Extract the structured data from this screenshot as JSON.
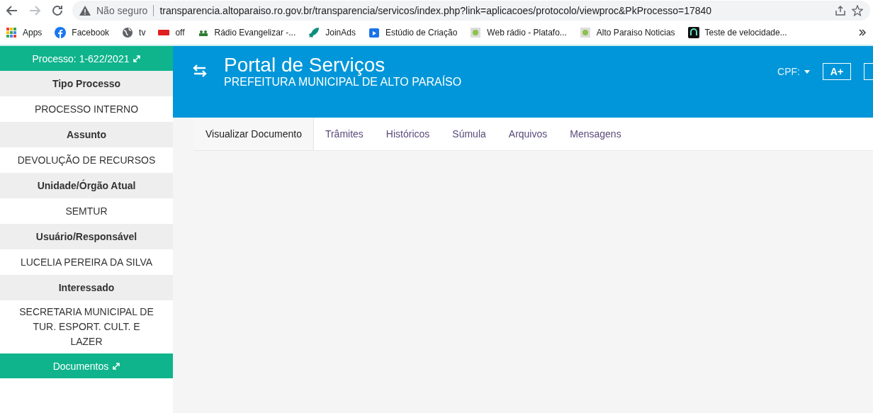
{
  "browser": {
    "security": "Não seguro",
    "url": "transparencia.altoparaiso.ro.gov.br/transparencia/servicos/index.php?link=aplicacoes/protocolo/viewproc&PkProcesso=17840",
    "bookmarks": [
      {
        "label": "Apps",
        "kind": "apps"
      },
      {
        "label": "Facebook",
        "kind": "facebook"
      },
      {
        "label": "tv",
        "kind": "globe"
      },
      {
        "label": "off",
        "kind": "badge"
      },
      {
        "label": "Rádio Evangelizar -...",
        "kind": "people"
      },
      {
        "label": "JoinAds",
        "kind": "rocket"
      },
      {
        "label": "Estúdio de Criação",
        "kind": "studio"
      },
      {
        "label": "Web rádio - Platafo...",
        "kind": "site"
      },
      {
        "label": "Alto Paraiso Noticias",
        "kind": "site"
      },
      {
        "label": "Teste de velocidade...",
        "kind": "speed"
      }
    ]
  },
  "sidebar": {
    "title": "Processo: 1-622/2021",
    "fields": [
      {
        "label": "Tipo Processo",
        "value": "PROCESSO INTERNO"
      },
      {
        "label": "Assunto",
        "value": "DEVOLUÇÃO DE RECURSOS"
      },
      {
        "label": "Unidade/Órgão Atual",
        "value": "SEMTUR"
      },
      {
        "label": "Usuário/Responsável",
        "value": "LUCELIA PEREIRA DA SILVA"
      },
      {
        "label": "Interessado",
        "value": "SECRETARIA MUNICIPAL DE TUR. ESPORT. CULT. E LAZER"
      }
    ],
    "documents": "Documentos"
  },
  "header": {
    "title": "Portal de Serviços",
    "subtitle": "PREFEITURA MUNICIPAL DE ALTO PARAÍSO",
    "cpf": "CPF:",
    "font_button": "A+"
  },
  "tabs": [
    {
      "label": "Visualizar Documento",
      "selected": true
    },
    {
      "label": "Trâmites",
      "selected": false
    },
    {
      "label": "Históricos",
      "selected": false
    },
    {
      "label": "Súmula",
      "selected": false
    },
    {
      "label": "Arquivos",
      "selected": false
    },
    {
      "label": "Mensagens",
      "selected": false
    }
  ]
}
